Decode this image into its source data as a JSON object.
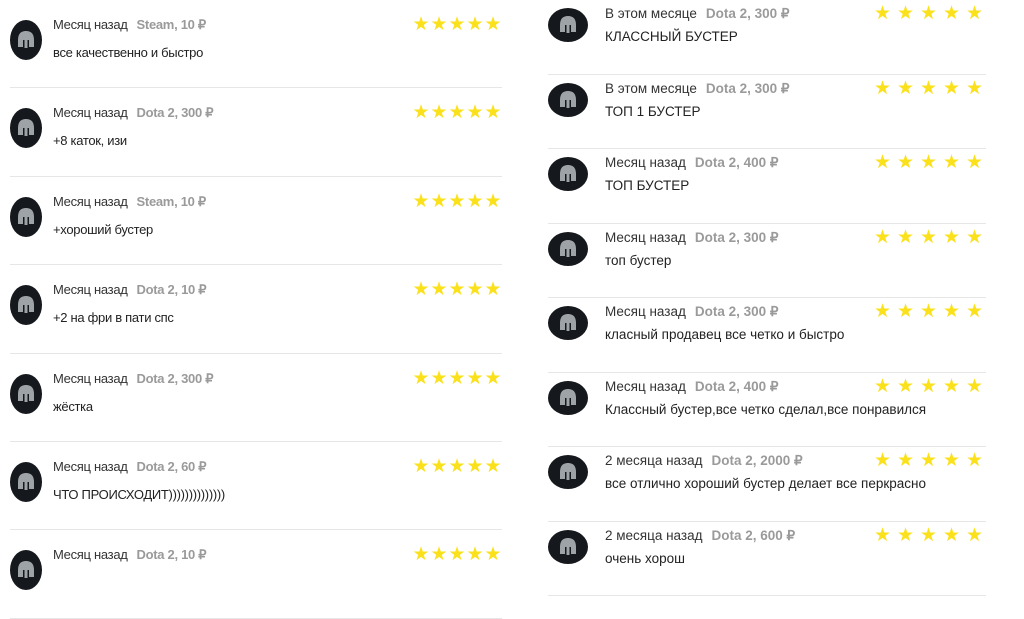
{
  "accent": {
    "star": "#fbe11c",
    "price": "#9a9a9a",
    "avatar": "#15181c"
  },
  "left": [
    {
      "when": "Месяц назад",
      "price": "Steam, 10 ₽",
      "text": "все качественно и быстро",
      "rating": 5
    },
    {
      "when": "Месяц назад",
      "price": "Dota 2, 300 ₽",
      "text": "+8 каток, изи",
      "rating": 5
    },
    {
      "when": "Месяц назад",
      "price": "Steam, 10 ₽",
      "text": "+хороший бустер",
      "rating": 5
    },
    {
      "when": "Месяц назад",
      "price": "Dota 2, 10 ₽",
      "text": "+2 на фри в пати спс",
      "rating": 5
    },
    {
      "when": "Месяц назад",
      "price": "Dota 2, 300 ₽",
      "text": "жёстка",
      "rating": 5
    },
    {
      "when": "Месяц назад",
      "price": "Dota 2, 60 ₽",
      "text": "ЧТО ПРОИСХОДИТ))))))))))))))",
      "rating": 5
    },
    {
      "when": "Месяц назад",
      "price": "Dota 2, 10 ₽",
      "text": "",
      "rating": 5
    }
  ],
  "right": [
    {
      "when": "В этом месяце",
      "price": "Dota 2, 300 ₽",
      "text": "КЛАССНЫЙ БУСТЕР",
      "rating": 5
    },
    {
      "when": "В этом месяце",
      "price": "Dota 2, 300 ₽",
      "text": "ТОП 1 БУСТЕР",
      "rating": 5
    },
    {
      "when": "Месяц назад",
      "price": "Dota 2, 400 ₽",
      "text": "ТОП БУСТЕР",
      "rating": 5
    },
    {
      "when": "Месяц назад",
      "price": "Dota 2, 300 ₽",
      "text": "топ бустер",
      "rating": 5
    },
    {
      "when": "Месяц назад",
      "price": "Dota 2, 300 ₽",
      "text": "класный продавец все четко и быстро",
      "rating": 5
    },
    {
      "when": "Месяц назад",
      "price": "Dota 2, 400 ₽",
      "text": "Классный бустер,все четко сделал,все понравился",
      "rating": 5
    },
    {
      "when": "2 месяца назад",
      "price": "Dota 2, 2000 ₽",
      "text": "все отлично хороший бустер делает все перкрасно",
      "rating": 5
    },
    {
      "when": "2 месяца назад",
      "price": "Dota 2, 600 ₽",
      "text": "очень хорош",
      "rating": 5
    }
  ]
}
